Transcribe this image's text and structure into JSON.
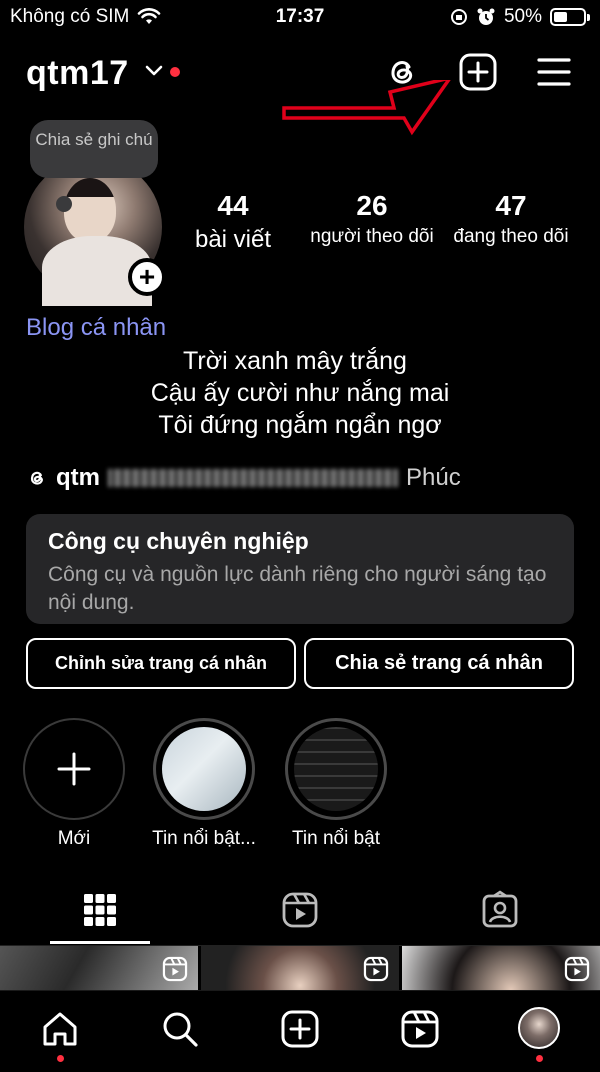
{
  "status_bar": {
    "carrier": "Không có SIM",
    "time": "17:37",
    "battery": "50%",
    "battery_level": 0.5
  },
  "header": {
    "username": "qtm17",
    "has_notification_dot": true
  },
  "profile": {
    "note_bubble": "Chia sẻ ghi chú",
    "stats": [
      {
        "value": "44",
        "label": "bài viết"
      },
      {
        "value": "26",
        "label": "người theo dõi"
      },
      {
        "value": "47",
        "label": "đang theo dõi"
      }
    ],
    "bio_link": "Blog cá nhân",
    "bio_lines": [
      "Trời xanh mây trắng",
      "Cậu ấy cười như nắng mai",
      "Tôi đứng ngắm ngẩn ngơ"
    ],
    "threads_handle": "qtm",
    "threads_rest": "Phúc"
  },
  "pro_dashboard": {
    "title": "Công cụ chuyên nghiệp",
    "subtitle": "Công cụ và nguồn lực dành riêng cho người sáng tạo nội dung."
  },
  "actions": {
    "edit_profile": "Chỉnh sửa trang cá nhân",
    "share_profile": "Chia sẻ trang cá nhân"
  },
  "highlights": [
    {
      "label": "Mới"
    },
    {
      "label": "Tin nổi bật..."
    },
    {
      "label": "Tin nổi bật"
    }
  ],
  "icons": {
    "header": [
      "threads-icon",
      "add-post-icon",
      "menu-icon"
    ],
    "tabs": [
      "grid-icon",
      "reels-icon",
      "tagged-icon"
    ],
    "nav": [
      "home-icon",
      "search-icon",
      "create-icon",
      "reels-icon",
      "profile-avatar"
    ]
  },
  "colors": {
    "accent_red": "#ff3040",
    "link": "#8b95f4",
    "card_bg": "#262628",
    "arrow_red": "#e0001a"
  }
}
